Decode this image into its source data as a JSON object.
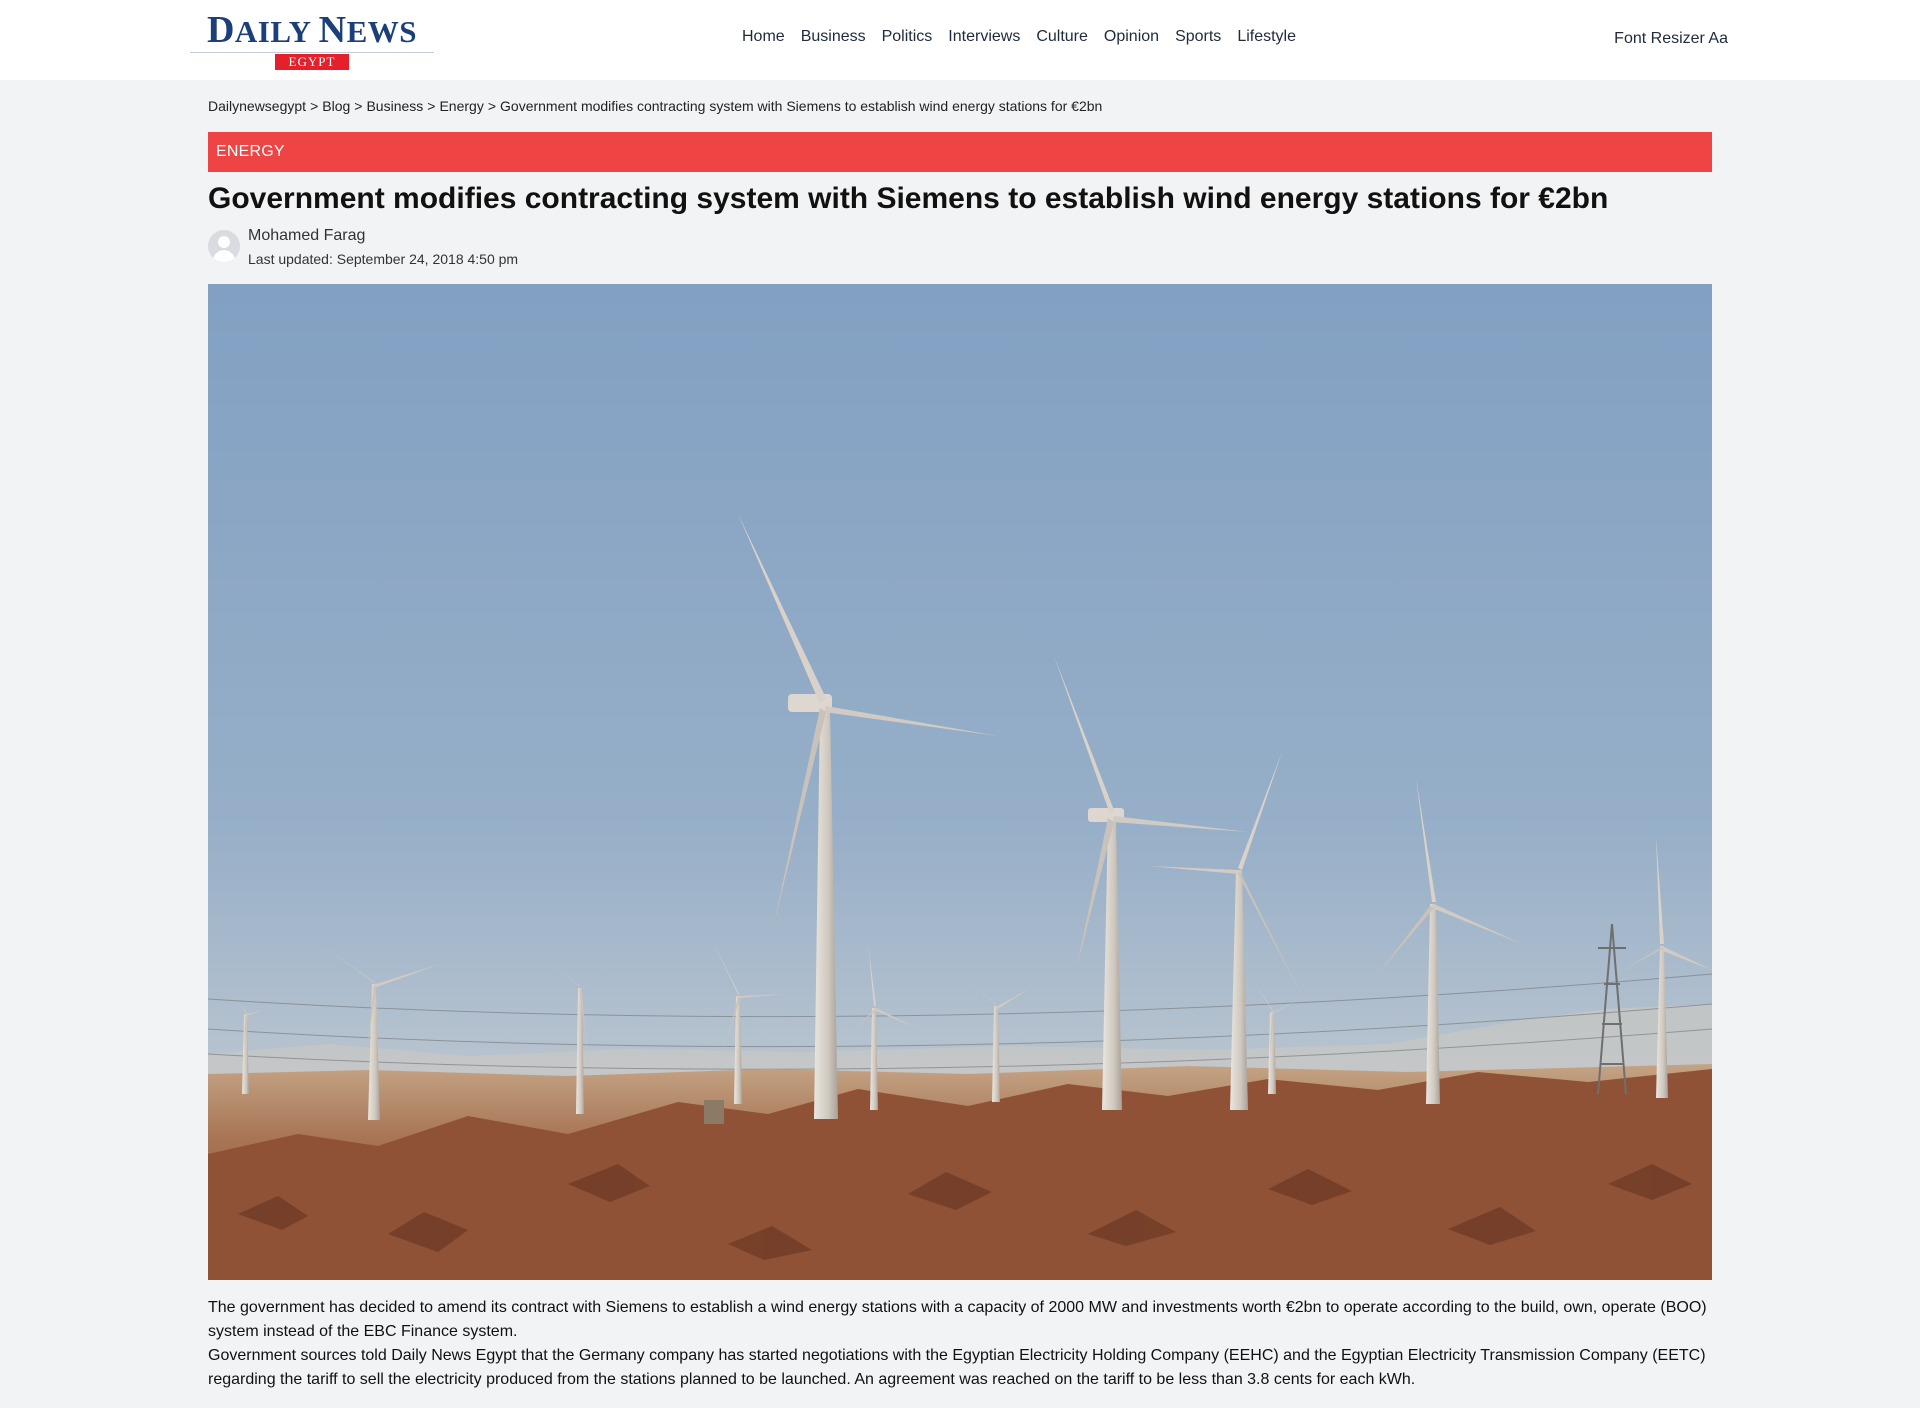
{
  "site": {
    "logo_main_first_letter": "D",
    "logo_main_rest": "AILY ",
    "logo_main_second_letter": "N",
    "logo_main_second_rest": "EWS",
    "logo_sub": "EGYPT",
    "brand_blue": "#1b3f7a",
    "brand_red": "#e5202a"
  },
  "nav": {
    "items": [
      "Home",
      "Business",
      "Politics",
      "Interviews",
      "Culture",
      "Opinion",
      "Sports",
      "Lifestyle"
    ],
    "font_resizer": "Font Resizer Aa"
  },
  "breadcrumb": {
    "items": [
      "Dailynewsegypt",
      "Blog",
      "Business",
      "Energy",
      "Government modifies contracting system with Siemens to establish wind energy stations for €2bn"
    ],
    "separator": ">"
  },
  "article": {
    "category": "ENERGY",
    "category_color": "#ef4444",
    "title": "Government modifies contracting system with Siemens to establish wind energy stations for €2bn",
    "author": "Mohamed Farag",
    "last_updated": "Last updated: September 24, 2018 4:50 pm",
    "hero_image_icon": "wind-turbines-desert-photo",
    "paragraphs": [
      "The government has decided to amend its contract with Siemens to establish a wind energy stations with a capacity of 2000 MW and investments worth €2bn to operate according to the build, own, operate (BOO) system instead of the EBC Finance system.",
      "Government sources told Daily News Egypt that the Germany company has started negotiations with the Egyptian Electricity Holding Company (EEHC) and the Egyptian Electricity Transmission Company (EETC) regarding the tariff to sell the electricity produced from the stations planned to be launched. An agreement was reached on the tariff to be less than 3.8 cents for each kWh."
    ]
  }
}
